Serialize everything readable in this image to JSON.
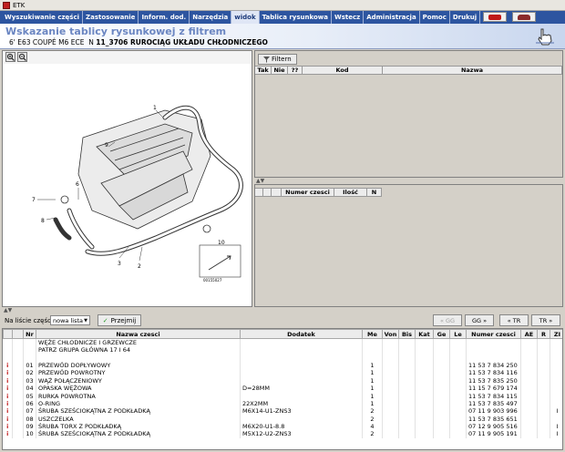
{
  "window": {
    "title": "ETK"
  },
  "menubar": {
    "items": [
      "Wyszukiwanie części",
      "Zastosowanie",
      "Inform. dod.",
      "Narzędzia",
      "widok",
      "Tablica rysunkowa",
      "Wstecz",
      "Administracja",
      "Pomoc",
      "Drukuj"
    ],
    "active_item": "widok"
  },
  "header": {
    "title": "Wskazanie tablicy rysunkowej z filtrem",
    "model": "6' E63 COUPÉ M6 ECE",
    "group_label": "N",
    "group_code": "11_3706 RUROCIĄG UKŁADU CHŁODNICZEGO"
  },
  "diagram": {
    "callouts": [
      "1",
      "2",
      "3",
      "4",
      "5",
      "6",
      "7",
      "8",
      "9",
      "10"
    ],
    "image_id": "00155027"
  },
  "filter_panel": {
    "filter_button": "Filtern",
    "columns": [
      "Tak",
      "Nie",
      "??",
      "Kod",
      "Nazwa"
    ]
  },
  "detail_panel": {
    "columns": [
      "Numer czesci",
      "Ilość",
      "N"
    ]
  },
  "toolbar": {
    "list_label": "Na liście części",
    "list_value": "nowa lista",
    "przejmij": "Przejmij",
    "nav_buttons": [
      "« GG",
      "GG »",
      "« TR",
      "TR »"
    ]
  },
  "parts_table": {
    "columns": [
      "Nr",
      "Nazwa czesci",
      "Dodatek",
      "Me",
      "Von",
      "Bis",
      "Kat",
      "Ge",
      "Le",
      "Numer czesci",
      "AE",
      "R",
      "ZI"
    ],
    "rows": [
      {
        "info": "",
        "nr": "",
        "name": "WĘŻE CHŁODNICZE I GRZEWCZE",
        "extra": "",
        "me": "",
        "part": "",
        "zi": ""
      },
      {
        "info": "",
        "nr": "",
        "name": "PATRZ GRUPA GŁÓWNA 17 I 64",
        "extra": "",
        "me": "",
        "part": "",
        "zi": ""
      },
      {
        "info": "",
        "nr": "",
        "name": "",
        "extra": "",
        "me": "",
        "part": "",
        "zi": ""
      },
      {
        "info": "i",
        "nr": "01",
        "name": "PRZEWÓD DOPŁYWOWY",
        "extra": "",
        "me": "1",
        "part": "11 53 7 834 250",
        "zi": ""
      },
      {
        "info": "i",
        "nr": "02",
        "name": "PRZEWÓD POWROTNY",
        "extra": "",
        "me": "1",
        "part": "11 53 7 834 116",
        "zi": ""
      },
      {
        "info": "i",
        "nr": "03",
        "name": "WĄŻ POŁĄCZENIOWY",
        "extra": "",
        "me": "1",
        "part": "11 53 7 835 250",
        "zi": ""
      },
      {
        "info": "i",
        "nr": "04",
        "name": "OPASKA WĘŻOWA",
        "extra": "D=28MM",
        "me": "1",
        "part": "11 15 7 679 174",
        "zi": ""
      },
      {
        "info": "i",
        "nr": "05",
        "name": "RURKA POWROTNA",
        "extra": "",
        "me": "1",
        "part": "11 53 7 834 115",
        "zi": ""
      },
      {
        "info": "i",
        "nr": "06",
        "name": "O-RING",
        "extra": "22X2MM",
        "me": "1",
        "part": "11 53 7 835 497",
        "zi": ""
      },
      {
        "info": "i",
        "nr": "07",
        "name": "ŚRUBA SZEŚCIOKĄTNA Z PODKŁADKĄ",
        "extra": "M6X14-U1-ZNS3",
        "me": "2",
        "part": "07 11 9 903 996",
        "zi": "I"
      },
      {
        "info": "i",
        "nr": "08",
        "name": "USZCZELKA",
        "extra": "",
        "me": "2",
        "part": "11 53 7 835 651",
        "zi": ""
      },
      {
        "info": "i",
        "nr": "09",
        "name": "ŚRUBA TORX Z PODKŁADKĄ",
        "extra": "M6X20-U1-8.8",
        "me": "4",
        "part": "07 12 9 905 516",
        "zi": "I"
      },
      {
        "info": "i",
        "nr": "10",
        "name": "ŚRUBA SZEŚCIOKĄTNA Z PODKŁADKĄ",
        "extra": "M5X12-U2-ZNS3",
        "me": "2",
        "part": "07 11 9 905 191",
        "zi": "I"
      }
    ]
  }
}
